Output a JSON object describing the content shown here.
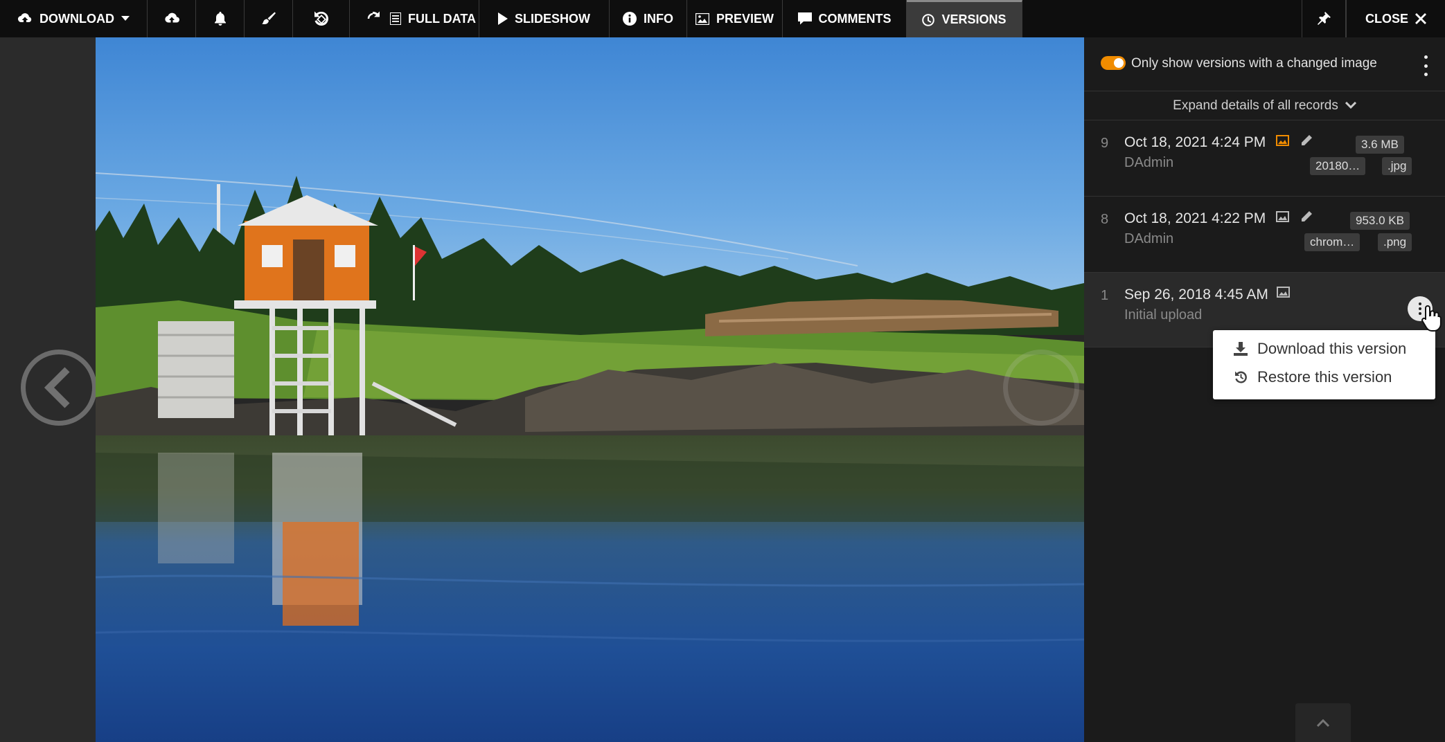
{
  "toolbar": {
    "download_label": "DOWNLOAD",
    "full_data_label": "FULL DATA",
    "slideshow_label": "SLIDESHOW",
    "info_label": "INFO",
    "preview_label": "PREVIEW",
    "comments_label": "COMMENTS",
    "versions_label": "VERSIONS",
    "close_label": "CLOSE"
  },
  "panel": {
    "toggle_label": "Only show versions with a changed image",
    "toggle_on": true,
    "expand_label": "Expand details of all records",
    "records": [
      {
        "number": "9",
        "date": "Oct 18, 2021 4:24 PM",
        "user": "DAdmin",
        "size": "3.6 MB",
        "filename": "20180…",
        "ext": ".jpg"
      },
      {
        "number": "8",
        "date": "Oct 18, 2021 4:22 PM",
        "user": "DAdmin",
        "size": "953.0 KB",
        "filename": "chrom…",
        "ext": ".png"
      },
      {
        "number": "1",
        "date": "Sep 26, 2018 4:45 AM",
        "user": "Initial upload"
      }
    ]
  },
  "context_menu": {
    "download_label": "Download this version",
    "restore_label": "Restore this version"
  },
  "colors": {
    "accent": "#f08c00",
    "toolbar_bg": "#0e0e0e",
    "panel_bg": "#1b1b1b"
  }
}
